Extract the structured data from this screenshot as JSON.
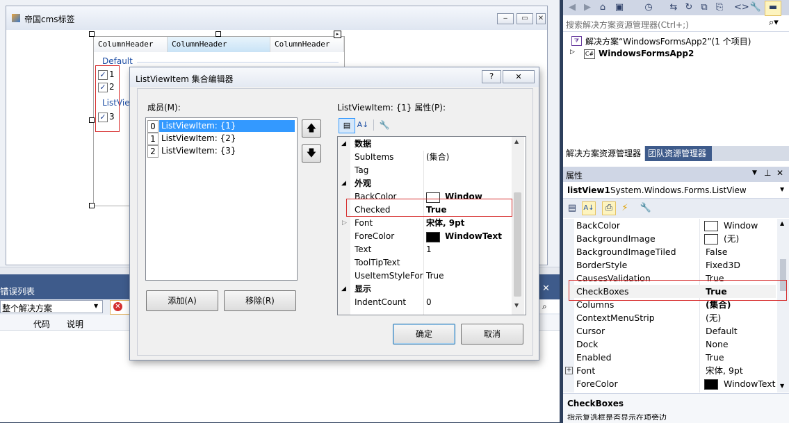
{
  "designer": {
    "form_title": "帝国cms标签",
    "listview": {
      "columns": [
        "ColumnHeader",
        "ColumnHeader",
        "ColumnHeader"
      ],
      "group_default": "Default",
      "group_listview": "ListView",
      "items": [
        "1",
        "2",
        "3"
      ],
      "check_mark": "✓"
    }
  },
  "error_list": {
    "title": "错误列表",
    "scope": "整个解决方案",
    "columns": [
      "代码",
      "说明"
    ]
  },
  "dialog": {
    "title": "ListViewItem 集合编辑器",
    "help": "?",
    "close": "✕",
    "members_label": "成员(M):",
    "members": [
      {
        "index": "0",
        "text": "ListViewItem: {1}"
      },
      {
        "index": "1",
        "text": "ListViewItem: {2}"
      },
      {
        "index": "2",
        "text": "ListViewItem: {3}"
      }
    ],
    "props_label": "ListViewItem: {1} 属性(P):",
    "add_button": "添加(A)",
    "remove_button": "移除(R)",
    "ok_button": "确定",
    "cancel_button": "取消",
    "grid": {
      "cat_data": "数据",
      "subitems_name": "SubItems",
      "subitems_value": "(集合)",
      "tag_name": "Tag",
      "cat_appearance": "外观",
      "backcolor_name": "BackColor",
      "backcolor_value": "Window",
      "checked_name": "Checked",
      "checked_value": "True",
      "font_name": "Font",
      "font_value": "宋体, 9pt",
      "forecolor_name": "ForeColor",
      "forecolor_value": "WindowText",
      "text_name": "Text",
      "text_value": "1",
      "tooltip_name": "ToolTipText",
      "useitem_name": "UseItemStyleForS",
      "useitem_value": "True",
      "cat_display": "显示",
      "indent_name": "IndentCount",
      "indent_value": "0"
    }
  },
  "solution_explorer": {
    "search_placeholder": "搜索解决方案资源管理器(Ctrl+;)",
    "solution_line": "解决方案“WindowsFormsApp2”(1 个项目)",
    "project_name": "WindowsFormsApp2",
    "tabs": [
      "解决方案资源管理器",
      "团队资源管理器"
    ]
  },
  "properties": {
    "title": "属性",
    "object_name": "listView1",
    "object_type": "System.Windows.Forms.ListView",
    "rows": [
      {
        "name": "BackColor",
        "value": "Window"
      },
      {
        "name": "BackgroundImage",
        "value": "(无)"
      },
      {
        "name": "BackgroundImageTiled",
        "value": "False"
      },
      {
        "name": "BorderStyle",
        "value": "Fixed3D"
      },
      {
        "name": "CausesValidation",
        "value": "True"
      },
      {
        "name": "CheckBoxes",
        "value": "True"
      },
      {
        "name": "Columns",
        "value": "(集合)"
      },
      {
        "name": "ContextMenuStrip",
        "value": "(无)"
      },
      {
        "name": "Cursor",
        "value": "Default"
      },
      {
        "name": "Dock",
        "value": "None"
      },
      {
        "name": "Enabled",
        "value": "True"
      },
      {
        "name": "Font",
        "value": "宋体, 9pt"
      },
      {
        "name": "ForeColor",
        "value": "WindowText"
      }
    ],
    "desc_title": "CheckBoxes",
    "desc_text": "指示复选框是否显示在项旁边"
  },
  "colors": {
    "selection": "#3399ff",
    "highlight_red": "#d62b2b",
    "tab_active": "#3e5b8b"
  }
}
